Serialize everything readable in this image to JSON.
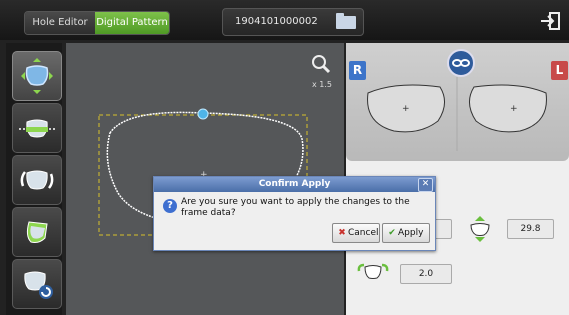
{
  "topbar": {
    "tabs": [
      {
        "label": "Hole Editor",
        "active": false
      },
      {
        "label": "Digital Pattern",
        "active": true
      }
    ],
    "job_number": "1904101000002",
    "folder_icon": "folder-icon",
    "exit_icon": "exit-icon"
  },
  "sidebar": {
    "tools": [
      {
        "name": "frame-shape-tool",
        "icon": "lens-expand-icon",
        "active": true
      },
      {
        "name": "frame-height-tool",
        "icon": "lens-height-icon",
        "active": false
      },
      {
        "name": "frame-rotate-tool",
        "icon": "lens-rotate-icon",
        "active": false
      },
      {
        "name": "frame-skew-tool",
        "icon": "lens-skew-icon",
        "active": false
      },
      {
        "name": "frame-reset-tool",
        "icon": "lens-reset-icon",
        "active": false
      }
    ]
  },
  "canvas": {
    "zoom_label": "x 1.5",
    "zoom_icon": "magnifier-icon"
  },
  "lens_panel": {
    "right_label": "R",
    "left_label": "L",
    "link_icon": "link-icon"
  },
  "measurements": {
    "height_value": "29.8",
    "bevel_value": "2.0"
  },
  "dialog": {
    "title": "Confirm Apply",
    "message": "Are you sure you want to apply the changes to the frame data?",
    "cancel_label": "Cancel",
    "apply_label": "Apply",
    "close_label": "✕"
  }
}
